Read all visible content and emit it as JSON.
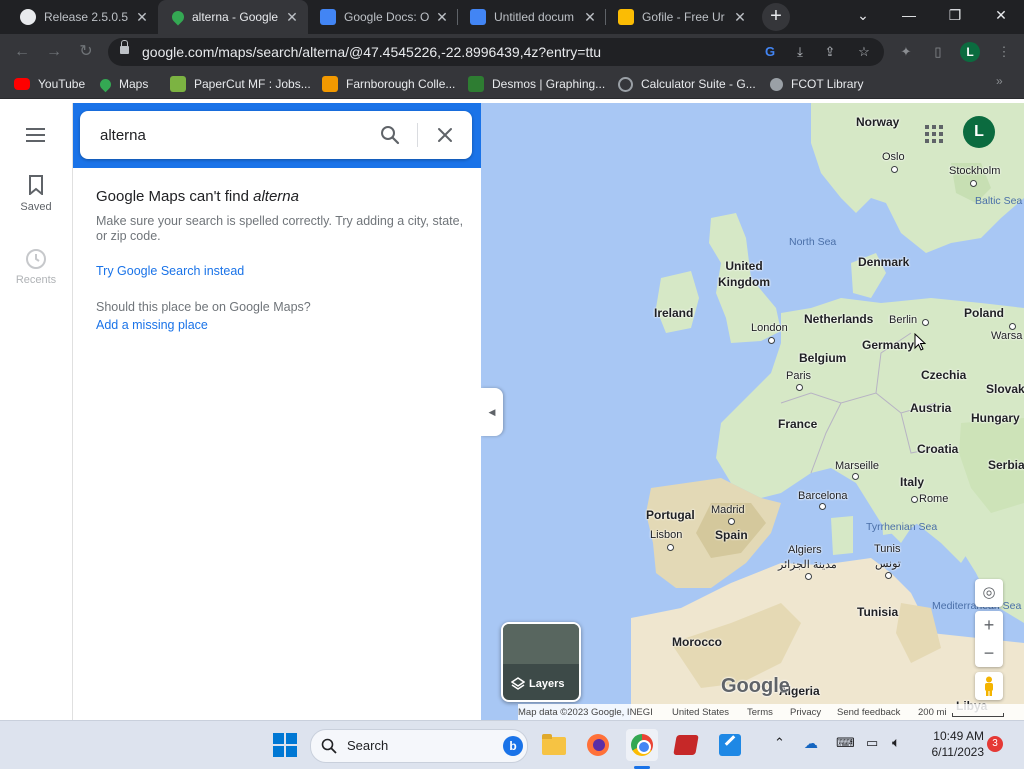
{
  "browser": {
    "tabs": [
      {
        "title": "Release 2.5.0.5",
        "icon": "github-icon"
      },
      {
        "title": "alterna - Google",
        "icon": "google-maps-icon",
        "active": true
      },
      {
        "title": "Google Docs: O",
        "icon": "google-docs-icon"
      },
      {
        "title": "Untitled docum",
        "icon": "docs-icon"
      },
      {
        "title": "Gofile - Free Ur",
        "icon": "gofile-icon"
      }
    ],
    "new_tab": "+",
    "url": "google.com/maps/search/alterna/@47.4545226,-22.8996439,4z?entry=ttu",
    "profile_initial": "L",
    "bookmarks": [
      {
        "label": "YouTube",
        "icon": "youtube-icon",
        "color": "#ff0000"
      },
      {
        "label": "Maps",
        "icon": "maps-icon",
        "color": "#34a853"
      },
      {
        "label": "PaperCut MF : Jobs...",
        "icon": "papercut-icon",
        "color": "#7cb342"
      },
      {
        "label": "Farnborough Colle...",
        "icon": "college-icon",
        "color": "#f29900"
      },
      {
        "label": "Desmos | Graphing...",
        "icon": "desmos-icon",
        "color": "#2e7d32"
      },
      {
        "label": "Calculator Suite - G...",
        "icon": "geogebra-icon",
        "color": "#9aa0a6"
      },
      {
        "label": "FCOT Library",
        "icon": "globe-icon",
        "color": "#9aa0a6"
      }
    ]
  },
  "rail": {
    "saved": "Saved",
    "recents": "Recents"
  },
  "search": {
    "value": "alterna"
  },
  "result": {
    "title_prefix": "Google Maps can't find ",
    "query": "alterna",
    "message": "Make sure your search is spelled correctly. Try adding a city, state, or zip code.",
    "try_link": "Try Google Search instead",
    "question": "Should this place be on Google Maps?",
    "add_link": "Add a missing place"
  },
  "map": {
    "avatar_initial": "L",
    "layers_label": "Layers",
    "logo": "Google",
    "countries": [
      "Norway",
      "Denmark",
      "United Kingdom",
      "Ireland",
      "Netherlands",
      "Belgium",
      "Germany",
      "Poland",
      "Czechia",
      "Slovakia",
      "Austria",
      "Hungary",
      "France",
      "Croatia",
      "Serbia",
      "Italy",
      "Portugal",
      "Spain",
      "Tunisia",
      "Morocco",
      "Algeria",
      "Libya"
    ],
    "cities": [
      "Oslo",
      "Stockholm",
      "London",
      "Berlin",
      "Warsa",
      "Paris",
      "Marseille",
      "Barcelona",
      "Madrid",
      "Lisbon",
      "Rome",
      "Algiers",
      "مدينة الجزائر",
      "Tunis",
      "تونس"
    ],
    "seas": [
      "North Sea",
      "Baltic Sea",
      "Tyrrhenian Sea",
      "Mediterranean Sea"
    ],
    "footer": {
      "data": "Map data ©2023 Google, INEGI",
      "country": "United States",
      "terms": "Terms",
      "privacy": "Privacy",
      "feedback": "Send feedback",
      "scale": "200 mi"
    }
  },
  "taskbar": {
    "search_label": "Search",
    "time": "10:49 AM",
    "date": "6/11/2023",
    "notifications": "3"
  }
}
